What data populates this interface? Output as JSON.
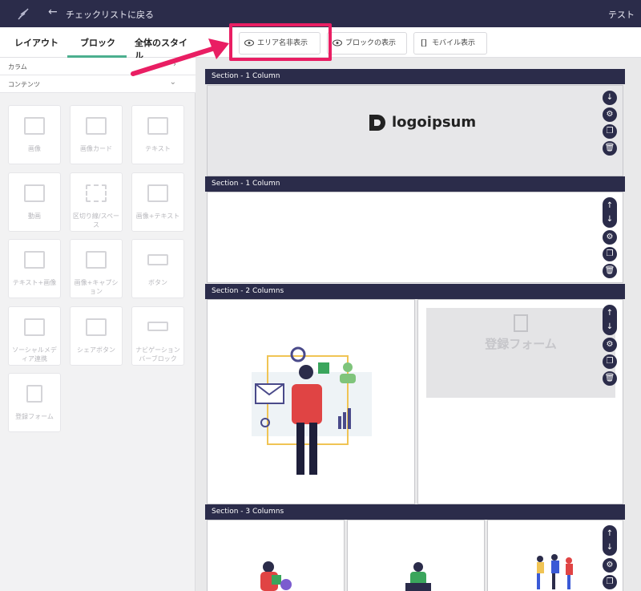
{
  "topbar": {
    "back_label": "チェックリストに戻る",
    "right_label": "テスト"
  },
  "sidebar": {
    "tabs": [
      {
        "label": "レイアウト"
      },
      {
        "label": "ブロック"
      },
      {
        "label": "全体のスタイル"
      }
    ],
    "categories": [
      {
        "label": "カラム"
      },
      {
        "label": "コンテンツ"
      }
    ],
    "blocks": [
      {
        "label": "画像"
      },
      {
        "label": "画像カード"
      },
      {
        "label": "テキスト"
      },
      {
        "label": "動画"
      },
      {
        "label": "区切り線/スペース"
      },
      {
        "label": "画像+テキスト"
      },
      {
        "label": "テキスト+画像"
      },
      {
        "label": "画像+キャプション"
      },
      {
        "label": "ボタン"
      },
      {
        "label": "ソーシャルメディア連携"
      },
      {
        "label": "シェアボタン"
      },
      {
        "label": "ナビゲーションバーブロック"
      },
      {
        "label": "登録フォーム"
      }
    ]
  },
  "toolbar": {
    "area_name_label": "エリア名非表示",
    "block_display_label": "ブロックの表示",
    "mobile_label": "モバイル表示"
  },
  "sections": [
    {
      "title": "Section - 1 Column"
    },
    {
      "title": "Section - 1 Column"
    },
    {
      "title": "Section - 2 Columns"
    },
    {
      "title": "Section - 3 Columns"
    }
  ],
  "logo_text": "logoipsum",
  "form_label": "登録フォーム",
  "colors": {
    "header": "#2b2c4a",
    "highlight": "#e91e63",
    "accent": "#4caf8f"
  }
}
